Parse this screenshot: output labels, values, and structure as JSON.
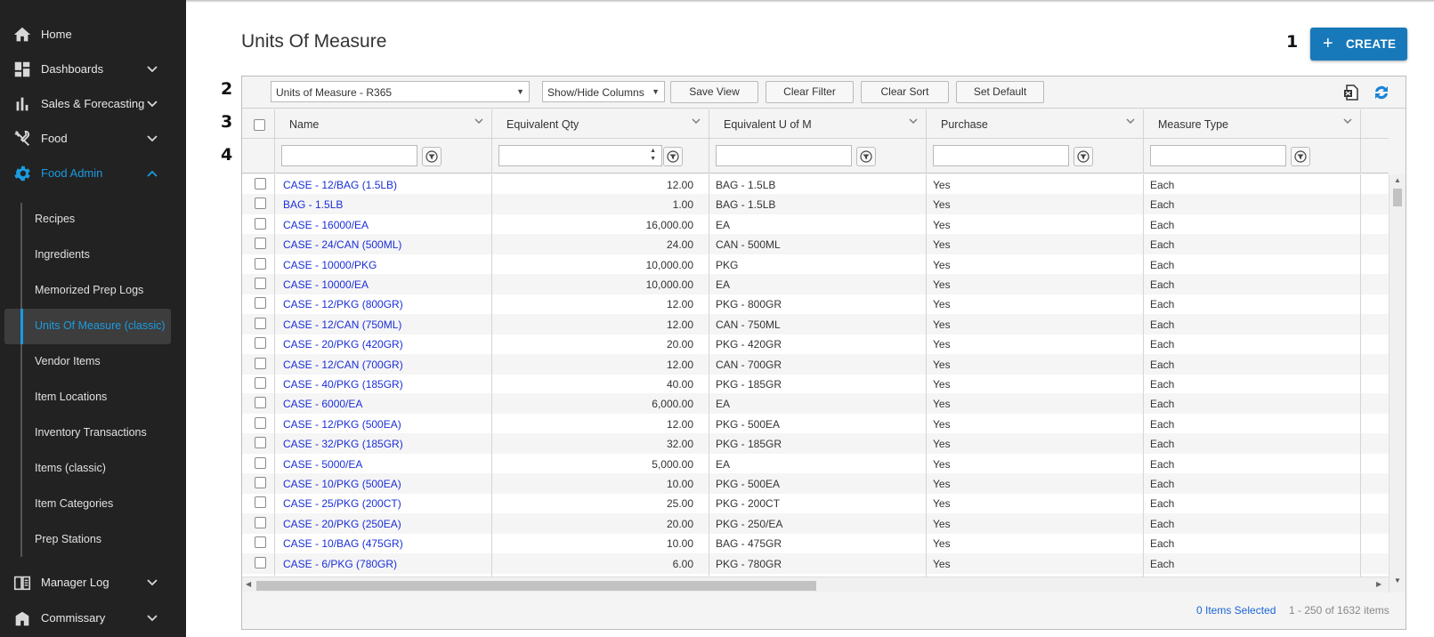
{
  "sidebar": {
    "items": [
      {
        "label": "Home",
        "icon": "home-icon",
        "expandable": false
      },
      {
        "label": "Dashboards",
        "icon": "dashboard-icon",
        "expandable": true
      },
      {
        "label": "Sales & Forecasting",
        "icon": "bar-chart-icon",
        "expandable": true
      },
      {
        "label": "Food",
        "icon": "utensils-icon",
        "expandable": true
      },
      {
        "label": "Food Admin",
        "icon": "gear-icon",
        "expandable": true,
        "expanded": true
      },
      {
        "label": "Manager Log",
        "icon": "book-icon",
        "expandable": true
      },
      {
        "label": "Commissary",
        "icon": "building-icon",
        "expandable": true
      }
    ],
    "sub_items": [
      {
        "label": "Recipes"
      },
      {
        "label": "Ingredients"
      },
      {
        "label": "Memorized Prep Logs"
      },
      {
        "label": "Units Of Measure (classic)",
        "selected": true
      },
      {
        "label": "Vendor Items"
      },
      {
        "label": "Item Locations"
      },
      {
        "label": "Inventory Transactions"
      },
      {
        "label": "Items (classic)"
      },
      {
        "label": "Item Categories"
      },
      {
        "label": "Prep Stations"
      }
    ]
  },
  "page": {
    "title": "Units Of Measure",
    "create_label": "CREATE"
  },
  "steps": [
    "1",
    "2",
    "3",
    "4"
  ],
  "toolbar": {
    "view_select": "Units of Measure - R365",
    "columns_select": "Show/Hide Columns",
    "save_view": "Save View",
    "clear_filter": "Clear Filter",
    "clear_sort": "Clear Sort",
    "set_default": "Set Default"
  },
  "columns": [
    "Name",
    "Equivalent Qty",
    "Equivalent U of M",
    "Purchase",
    "Measure Type"
  ],
  "rows": [
    {
      "name": "CASE - 12/BAG (1.5LB)",
      "qty": "12.00",
      "uom": "BAG - 1.5LB",
      "purchase": "Yes",
      "type": "Each"
    },
    {
      "name": "BAG - 1.5LB",
      "qty": "1.00",
      "uom": "BAG - 1.5LB",
      "purchase": "Yes",
      "type": "Each"
    },
    {
      "name": "CASE - 16000/EA",
      "qty": "16,000.00",
      "uom": "EA",
      "purchase": "Yes",
      "type": "Each"
    },
    {
      "name": "CASE - 24/CAN (500ML)",
      "qty": "24.00",
      "uom": "CAN - 500ML",
      "purchase": "Yes",
      "type": "Each"
    },
    {
      "name": "CASE - 10000/PKG",
      "qty": "10,000.00",
      "uom": "PKG",
      "purchase": "Yes",
      "type": "Each"
    },
    {
      "name": "CASE - 10000/EA",
      "qty": "10,000.00",
      "uom": "EA",
      "purchase": "Yes",
      "type": "Each"
    },
    {
      "name": "CASE - 12/PKG (800GR)",
      "qty": "12.00",
      "uom": "PKG - 800GR",
      "purchase": "Yes",
      "type": "Each"
    },
    {
      "name": "CASE - 12/CAN (750ML)",
      "qty": "12.00",
      "uom": "CAN - 750ML",
      "purchase": "Yes",
      "type": "Each"
    },
    {
      "name": "CASE - 20/PKG (420GR)",
      "qty": "20.00",
      "uom": "PKG - 420GR",
      "purchase": "Yes",
      "type": "Each"
    },
    {
      "name": "CASE - 12/CAN (700GR)",
      "qty": "12.00",
      "uom": "CAN - 700GR",
      "purchase": "Yes",
      "type": "Each"
    },
    {
      "name": "CASE - 40/PKG (185GR)",
      "qty": "40.00",
      "uom": "PKG - 185GR",
      "purchase": "Yes",
      "type": "Each"
    },
    {
      "name": "CASE - 6000/EA",
      "qty": "6,000.00",
      "uom": "EA",
      "purchase": "Yes",
      "type": "Each"
    },
    {
      "name": "CASE - 12/PKG (500EA)",
      "qty": "12.00",
      "uom": "PKG - 500EA",
      "purchase": "Yes",
      "type": "Each"
    },
    {
      "name": "CASE - 32/PKG (185GR)",
      "qty": "32.00",
      "uom": "PKG - 185GR",
      "purchase": "Yes",
      "type": "Each"
    },
    {
      "name": "CASE - 5000/EA",
      "qty": "5,000.00",
      "uom": "EA",
      "purchase": "Yes",
      "type": "Each"
    },
    {
      "name": "CASE - 10/PKG (500EA)",
      "qty": "10.00",
      "uom": "PKG - 500EA",
      "purchase": "Yes",
      "type": "Each"
    },
    {
      "name": "CASE - 25/PKG (200CT)",
      "qty": "25.00",
      "uom": "PKG - 200CT",
      "purchase": "Yes",
      "type": "Each"
    },
    {
      "name": "CASE - 20/PKG (250EA)",
      "qty": "20.00",
      "uom": "PKG - 250/EA",
      "purchase": "Yes",
      "type": "Each"
    },
    {
      "name": "CASE - 10/BAG (475GR)",
      "qty": "10.00",
      "uom": "BAG - 475GR",
      "purchase": "Yes",
      "type": "Each"
    },
    {
      "name": "CASE - 6/PKG (780GR)",
      "qty": "6.00",
      "uom": "PKG - 780GR",
      "purchase": "Yes",
      "type": "Each"
    }
  ],
  "footer": {
    "selected": "0 Items Selected",
    "range": "1 - 250 of 1632 items"
  },
  "colors": {
    "sidebar_bg": "#222222",
    "accent": "#1a9be0",
    "create_bg": "#1779ba",
    "link": "#1a2fd6"
  }
}
